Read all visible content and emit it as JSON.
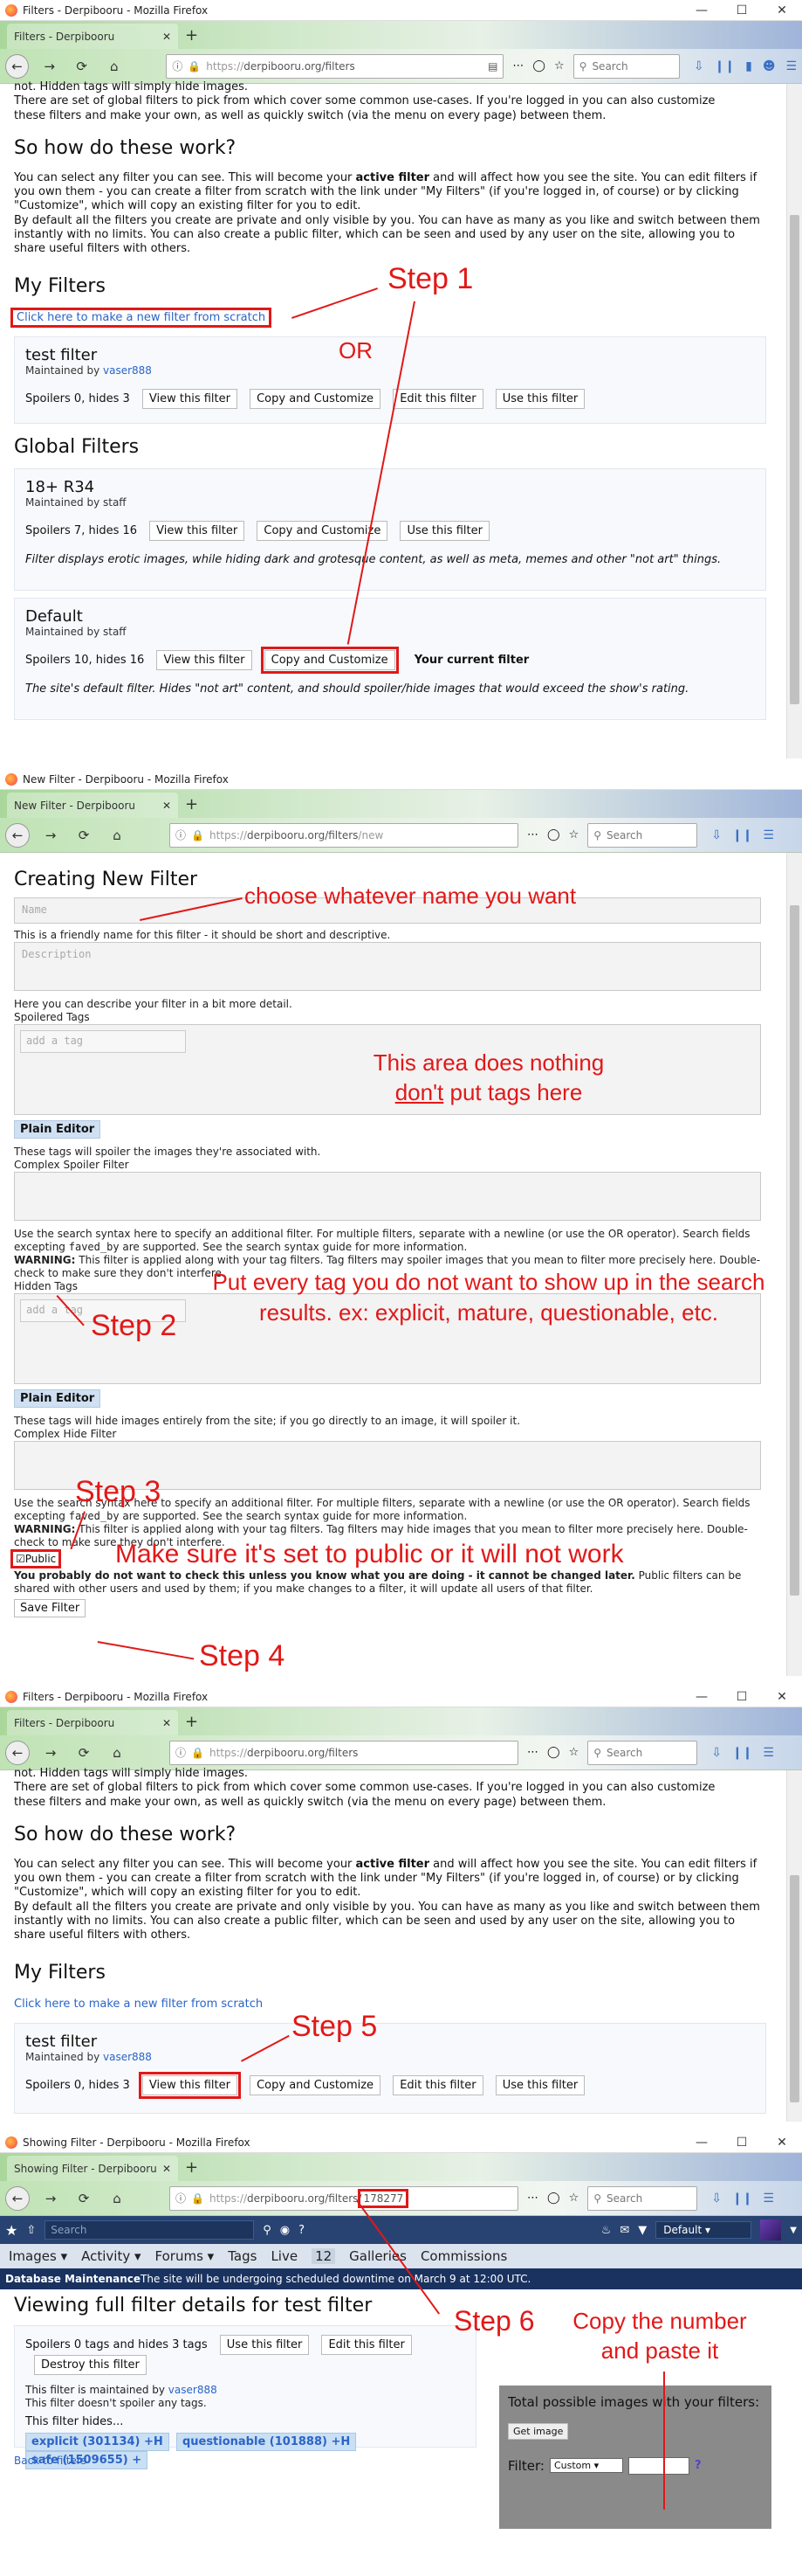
{
  "panel1": {
    "window_title": "Filters - Derpibooru - Mozilla Firefox",
    "tab_title": "Filters - Derpibooru",
    "url_prefix": "https://",
    "url_main": "derpibooru.org/filters",
    "search_placeholder": "Search",
    "cut_text": "not. Hidden tags will simply hide images.",
    "intro": "There are set of global filters to pick from which cover some common use-cases. If you're logged in you can also customize these filters and make your own, as well as quickly switch (via the menu on every page) between them.",
    "how_heading": "So how do these work?",
    "how_p1_a": "You can select any filter you can see. This will become your ",
    "how_p1_bold": "active filter",
    "how_p1_b": " and will affect how you see the site. You can edit filters if you own them - you can create a filter from scratch with the link under \"My Filters\" (if you're logged in, of course) or by clicking \"Customize\", which will copy an existing filter for you to edit.",
    "how_p2": "By default all the filters you create are private and only visible by you. You can have as many as you like and switch between them instantly with no limits. You can also create a public filter, which can be seen and used by any user on the site, allowing you to share useful filters with others.",
    "my_filters_heading": "My Filters",
    "new_filter_link": "Click here to make a new filter from scratch",
    "test_filter": {
      "name": "test filter",
      "maintained_prefix": "Maintained by ",
      "maintainer": "vaser888",
      "stats": "Spoilers 0, hides 3"
    },
    "buttons": {
      "view": "View this filter",
      "copy": "Copy and Customize",
      "edit": "Edit this filter",
      "use": "Use this filter"
    },
    "global_heading": "Global Filters",
    "r34": {
      "name": "18+ R34",
      "maintained": "Maintained by staff",
      "stats": "Spoilers 7, hides 16",
      "desc": "Filter displays erotic images, while hiding dark and grotesque content, as well as meta, memes and other \"not art\" things."
    },
    "default": {
      "name": "Default",
      "maintained": "Maintained by staff",
      "stats": "Spoilers 10, hides 16",
      "current": "Your current filter",
      "desc": "The site's default filter. Hides \"not art\" content, and should spoiler/hide images that would exceed the show's rating."
    },
    "ann_step1": "Step 1",
    "ann_or": "OR"
  },
  "panel2": {
    "window_title": "New Filter - Derpibooru - Mozilla Firefox",
    "tab_title": "New Filter - Derpibooru",
    "url_prefix": "https://",
    "url_main": "derpibooru.org/filters",
    "url_rest": "/new",
    "search_placeholder": "Search",
    "heading": "Creating New Filter",
    "name_placeholder": "Name",
    "name_help": "This is a friendly name for this filter - it should be short and descriptive.",
    "desc_placeholder": "Description",
    "desc_help": "Here you can describe your filter in a bit more detail.",
    "spoilered_label": "Spoilered Tags",
    "tag_placeholder": "add a tag",
    "plain_editor": "Plain Editor",
    "spoiler_help": "These tags will spoiler the images they're associated with.",
    "complex_spoiler_label": "Complex Spoiler Filter",
    "syntax_help_a": "Use the search syntax here to specify an additional filter. For multiple filters, separate with a newline (or use the OR operator). Search fields excepting ",
    "syntax_code": "faved_by",
    "syntax_help_b": " are supported. See the search syntax guide for more information.",
    "warning_bold": "WARNING:",
    "warning_spoiler": " This filter is applied along with your tag filters. Tag filters may spoiler images that you mean to filter more precisely here. Double-check to make sure they don't interfere.",
    "hidden_label": "Hidden Tags",
    "hidden_help": "These tags will hide images entirely from the site; if you go directly to an image, it will spoiler it.",
    "complex_hide_label": "Complex Hide Filter",
    "warning_hide": " This filter is applied along with your tag filters. Tag filters may hide images that you mean to filter more precisely here. Double-check to make sure they don't interfere.",
    "public_label": "Public",
    "public_help_bold": "You probably do not want to check this unless you know what you are doing - it cannot be changed later.",
    "public_help": " Public filters can be shared with other users and used by them; if you make changes to a filter, it will update all users of that filter.",
    "save_button": "Save Filter",
    "ann_choose": "choose whatever name you want",
    "ann_nothing_1": "This area does nothing",
    "ann_nothing_dont": "don't",
    "ann_nothing_2": " put tags here",
    "ann_step2": "Step 2",
    "ann_hidden": "Put every tag you do not want to show up in the search results. ex: explicit, mature, questionable, etc.",
    "ann_step3": "Step 3",
    "ann_public": "Make sure it's set to public or it will not work",
    "ann_step4": "Step 4"
  },
  "panel3": {
    "window_title": "Filters - Derpibooru - Mozilla Firefox",
    "tab_title": "Filters - Derpibooru",
    "ann_step5": "Step 5"
  },
  "panel4": {
    "window_title": "Showing Filter - Derpibooru - Mozilla Firefox",
    "tab_title": "Showing Filter - Derpibooru",
    "url_prefix": "https://",
    "url_main": "derpibooru.org/filters/",
    "url_id": "178277",
    "search_placeholder": "Search",
    "db_search_placeholder": "Search",
    "filter_select": "Default",
    "nav": [
      "Images",
      "Activity",
      "Forums",
      "Tags",
      "Live",
      "12",
      "Galleries",
      "Commissions"
    ],
    "maint_bold": "Database Maintenance",
    "maint_text": " The site will be undergoing scheduled downtime on March 9 at 12:00 UTC.",
    "heading": "Viewing full filter details for test filter",
    "summary": "Spoilers 0 tags and hides 3 tags",
    "use_btn": "Use this filter",
    "edit_btn": "Edit this filter",
    "destroy_btn": "Destroy this filter",
    "maintained_prefix": "This filter is maintained by ",
    "maintainer": "vaser888",
    "no_spoiler": "This filter doesn't spoiler any tags.",
    "hides_label": "This filter hides...",
    "tags": [
      {
        "name": "explicit",
        "count": "(301134)",
        "mark": "+H"
      },
      {
        "name": "questionable",
        "count": "(101888)",
        "mark": "+H"
      },
      {
        "name": "safe",
        "count": "(1509655)",
        "mark": "+"
      }
    ],
    "total_box_title": "Total possible images with your filters:",
    "get_image": "Get image",
    "filter_label": "Filter:",
    "custom_option": "Custom",
    "back_link": "Back to filters",
    "ann_step6": "Step 6",
    "ann_copy": "Copy the number and paste it"
  },
  "colors": {
    "annotation": "#e21818",
    "link": "#2b64c8",
    "db_nav": "#284371"
  }
}
